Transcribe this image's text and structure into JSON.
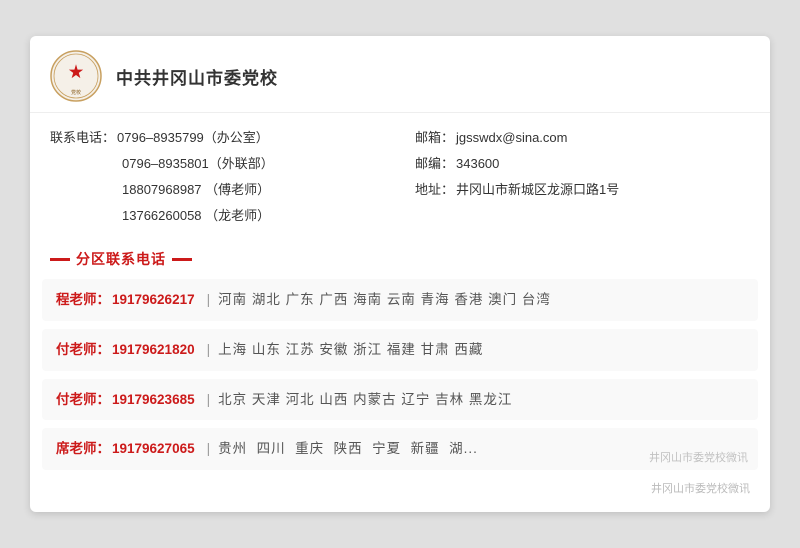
{
  "org": {
    "title": "中共井冈山市委党校",
    "logo_alt": "中共井冈山市委党校徽标"
  },
  "contact_left": {
    "label1": "联系电话：",
    "phone1": "0796–8935799（办公室）",
    "phone2": "0796–8935801（外联部）",
    "phone3": "18807968987 （傅老师）",
    "phone4": "13766260058 （龙老师）"
  },
  "contact_right": {
    "email_label": "邮箱：",
    "email": "jgsswdx@sina.com",
    "postcode_label": "邮编：",
    "postcode": "343600",
    "address_label": "地址：",
    "address": "井冈山市新城区龙源口路1号"
  },
  "section_title": "分区联系电话",
  "regions": [
    {
      "teacher": "程老师：",
      "phone": "19179626217",
      "areas": "河南  湖北  广东  广西  海南  云南  青海  香港  澳门  台湾"
    },
    {
      "teacher": "付老师：",
      "phone": "19179621820",
      "areas": "上海  山东  江苏  安徽  浙江  福建  甘肃  西藏"
    },
    {
      "teacher": "付老师：",
      "phone": "19179623685",
      "areas": "北京  天津  河北  山西  内蒙古  辽宁  吉林  黑龙江"
    },
    {
      "teacher": "席老师：",
      "phone": "19179627065",
      "areas": "贵州  四川  重庆  陕西  宁夏  新疆  湖..."
    }
  ],
  "watermark": "井冈山市委党校微讯"
}
